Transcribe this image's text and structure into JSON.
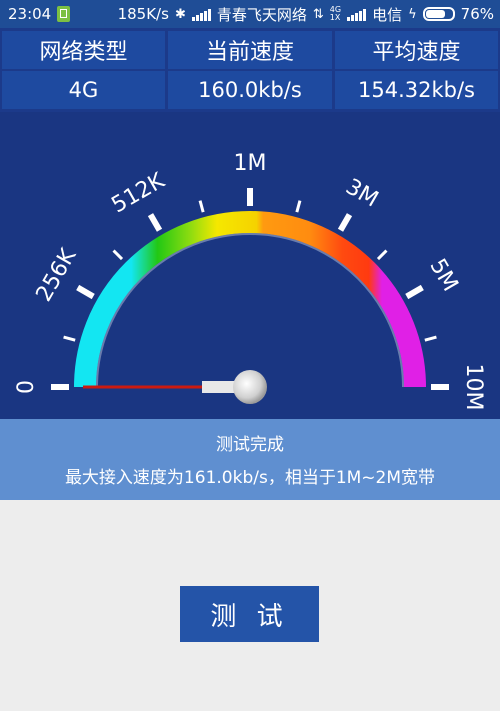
{
  "status_bar": {
    "time": "23:04",
    "net_speed": "185K/s",
    "carrier1": "青春飞天网络",
    "net_type_4g": "4G",
    "net_type_1x": "1X",
    "carrier2": "电信",
    "battery_percent": "76%",
    "battery_level": 0.76
  },
  "table": {
    "headers": [
      "网络类型",
      "当前速度",
      "平均速度"
    ],
    "values": [
      "4G",
      "160.0kb/s",
      "154.32kb/s"
    ]
  },
  "gauge": {
    "scale_labels": [
      "0",
      "256K",
      "512K",
      "1M",
      "3M",
      "5M",
      "10M"
    ],
    "needle_value_fraction": 0.0
  },
  "result": {
    "status": "测试完成",
    "summary": "最大接入速度为161.0kb/s，相当于1M~2M宽带"
  },
  "button": {
    "label": "测 试"
  }
}
